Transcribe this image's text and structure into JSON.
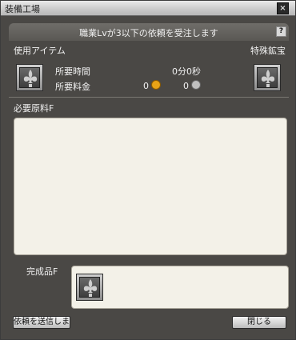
{
  "window": {
    "title": "装備工場",
    "close_glyph": "×"
  },
  "header": {
    "notice": "職業Lvが3以下の依頼を受注します",
    "help_glyph": "?"
  },
  "slots": {
    "use_item_label": "使用アイテム",
    "special_label": "特殊鉱宝",
    "icon": "fleur-de-lis-icon"
  },
  "requirements": {
    "time_label": "所要時間",
    "time_value": "0分0秒",
    "fee_label": "所要料金",
    "gold_value": "0",
    "silver_value": "0",
    "gold_color": "#e8a317",
    "silver_color": "#c0c0c0"
  },
  "materials": {
    "label": "必要原料F"
  },
  "product": {
    "label": "完成品F"
  },
  "footer": {
    "submit_label": "依頼を送信しま",
    "close_label": "閉じる"
  },
  "colors": {
    "window_bg": "#4a4845",
    "panel_bg": "#f3f1e8"
  }
}
